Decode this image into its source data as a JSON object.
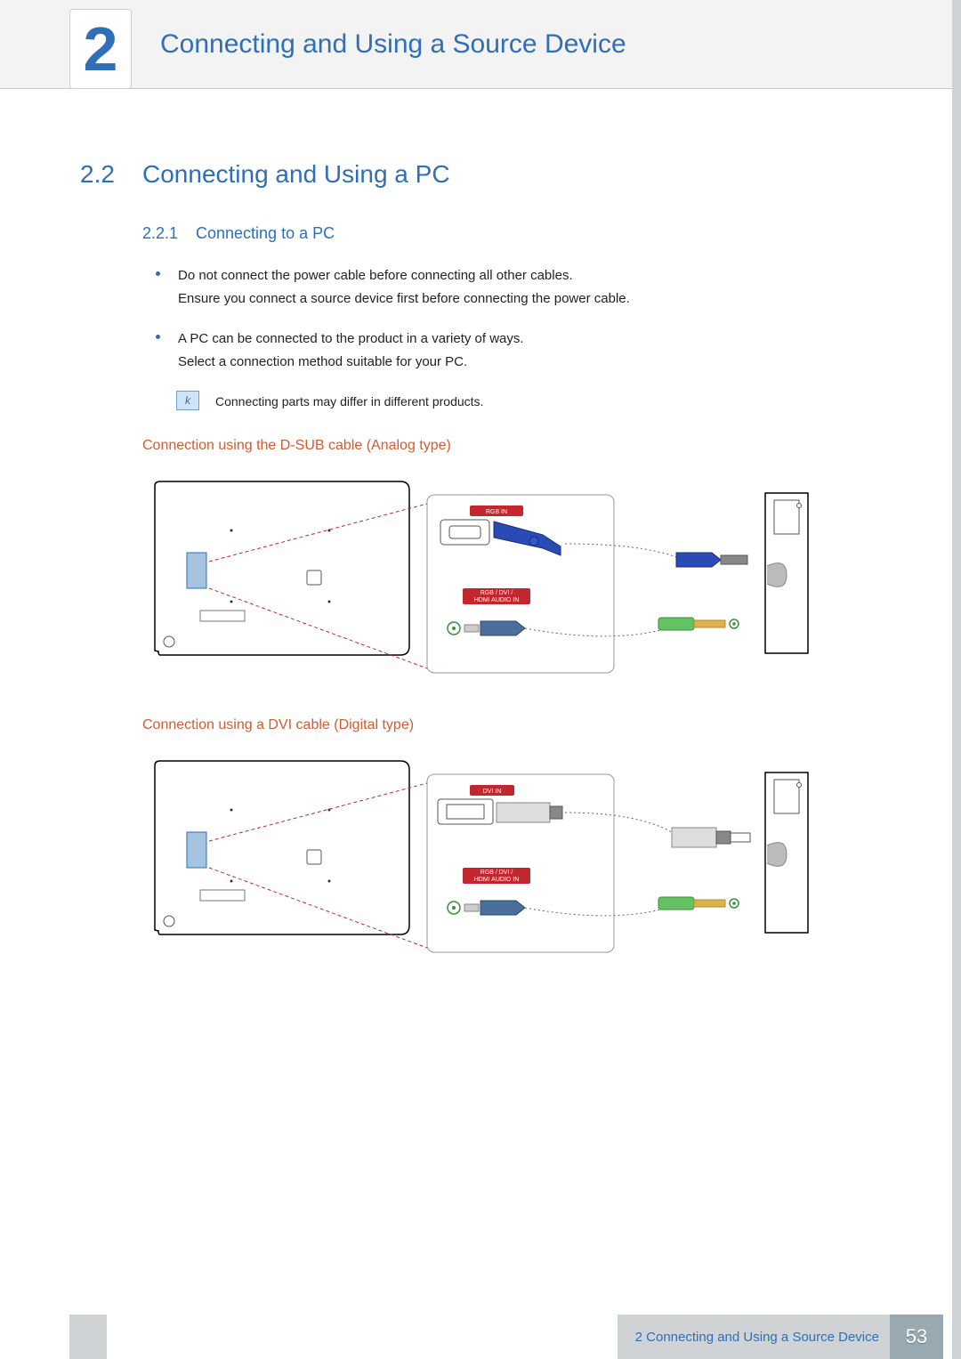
{
  "header": {
    "chapter_number": "2",
    "chapter_title": "Connecting and Using a Source Device"
  },
  "section": {
    "number": "2.2",
    "title": "Connecting and Using a PC"
  },
  "subsection": {
    "number": "2.2.1",
    "title": "Connecting to a PC"
  },
  "bullets": [
    {
      "line1": "Do not connect the power cable before connecting all other cables.",
      "line2": "Ensure you connect a source device first before connecting the power cable."
    },
    {
      "line1": "A PC can be connected to the product in a variety of ways.",
      "line2": "Select a connection method suitable for your PC."
    }
  ],
  "note_text": "Connecting parts may differ in different products.",
  "diagram1": {
    "heading": "Connection using the D-SUB cable (Analog type)",
    "port1_label": "RGB IN",
    "port2_label_l1": "RGB / DVI /",
    "port2_label_l2": "HDMI AUDIO IN"
  },
  "diagram2": {
    "heading": "Connection using a DVI cable (Digital type)",
    "port1_label": "DVI IN",
    "port2_label_l1": "RGB / DVI /",
    "port2_label_l2": "HDMI AUDIO IN"
  },
  "footer": {
    "chapter_ref": "2 Connecting and Using a Source Device",
    "page_number": "53"
  }
}
